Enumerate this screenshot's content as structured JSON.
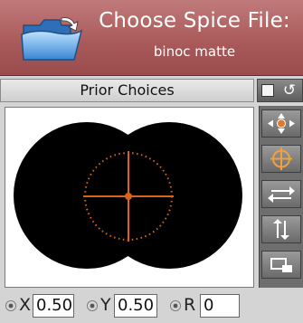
{
  "header": {
    "title": "Choose Spice File:",
    "filename": "binoc matte"
  },
  "prior_choices": {
    "label": "Prior Choices"
  },
  "top_tools": {
    "toggle_icon": "square-toggle-icon",
    "reset_icon": "rotate-icon"
  },
  "canvas": {
    "matte_shape": "binocular",
    "matte_color": "#000000",
    "background_color": "#ffffff",
    "crosshair_color": "#d8641a"
  },
  "tools": [
    {
      "name": "move-icon"
    },
    {
      "name": "crosshair-target-icon"
    },
    {
      "name": "flip-horizontal-icon"
    },
    {
      "name": "flip-vertical-icon"
    },
    {
      "name": "reset-frame-icon"
    }
  ],
  "fields": {
    "x_label": "X",
    "x_value": "0.50",
    "y_label": "Y",
    "y_value": "0.50",
    "r_label": "R",
    "r_value": "0"
  }
}
